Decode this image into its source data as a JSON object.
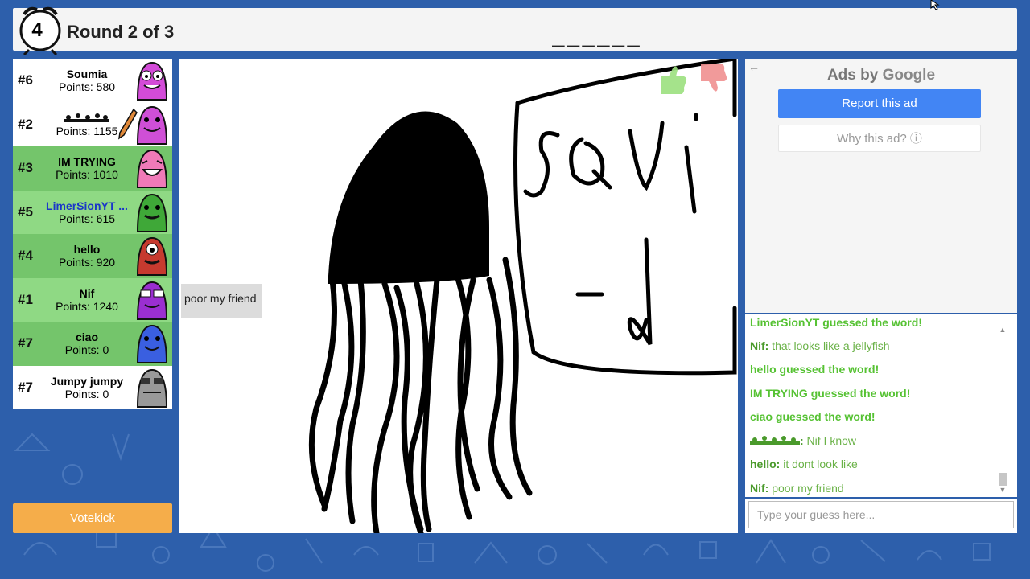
{
  "header": {
    "timer": "4",
    "round_text": "Round 2 of 3",
    "word_hint": "______"
  },
  "players": [
    {
      "rank": "#6",
      "name": "Soumia",
      "points": "Points: 580"
    },
    {
      "rank": "#2",
      "name": "",
      "points": "Points: 1155"
    },
    {
      "rank": "#3",
      "name": "IM TRYING",
      "points": "Points: 1010"
    },
    {
      "rank": "#5",
      "name": "LimerSionYT ...",
      "points": "Points: 615"
    },
    {
      "rank": "#4",
      "name": "hello",
      "points": "Points: 920"
    },
    {
      "rank": "#1",
      "name": "Nif",
      "points": "Points: 1240"
    },
    {
      "rank": "#7",
      "name": "ciao",
      "points": "Points: 0"
    },
    {
      "rank": "#7",
      "name": "Jumpy jumpy",
      "points": "Points: 0"
    }
  ],
  "votekick_label": "Votekick",
  "speech_bubble": "poor my friend",
  "ads": {
    "back_arrow": "←",
    "title_prefix": "Ads by ",
    "title_brand": "Google",
    "report_label": "Report this ad",
    "why_label": "Why this ad? ⓘ"
  },
  "chat": {
    "messages": [
      {
        "type": "guess",
        "text": "LimerSionYT guessed the word!"
      },
      {
        "type": "dialog",
        "who": "Nif:",
        "text": " that looks like a jellyfish"
      },
      {
        "type": "guess",
        "text": "hello guessed the word!"
      },
      {
        "type": "guess",
        "text": "IM TRYING guessed the word!"
      },
      {
        "type": "guess",
        "text": "ciao guessed the word!"
      },
      {
        "type": "dialog",
        "who": ":",
        "text": " Nif I know"
      },
      {
        "type": "dialog",
        "who": "hello:",
        "text": " it dont look like"
      },
      {
        "type": "dialog",
        "who": "Nif:",
        "text": " poor my friend"
      }
    ],
    "input_placeholder": "Type your guess here..."
  },
  "colors": {
    "background": "#2d5fab",
    "green_row": "#74c56b",
    "light_green_row": "#8fd984",
    "votekick": "#f5ad4a",
    "report_button": "#4285f4",
    "guess_text": "#56c233"
  }
}
